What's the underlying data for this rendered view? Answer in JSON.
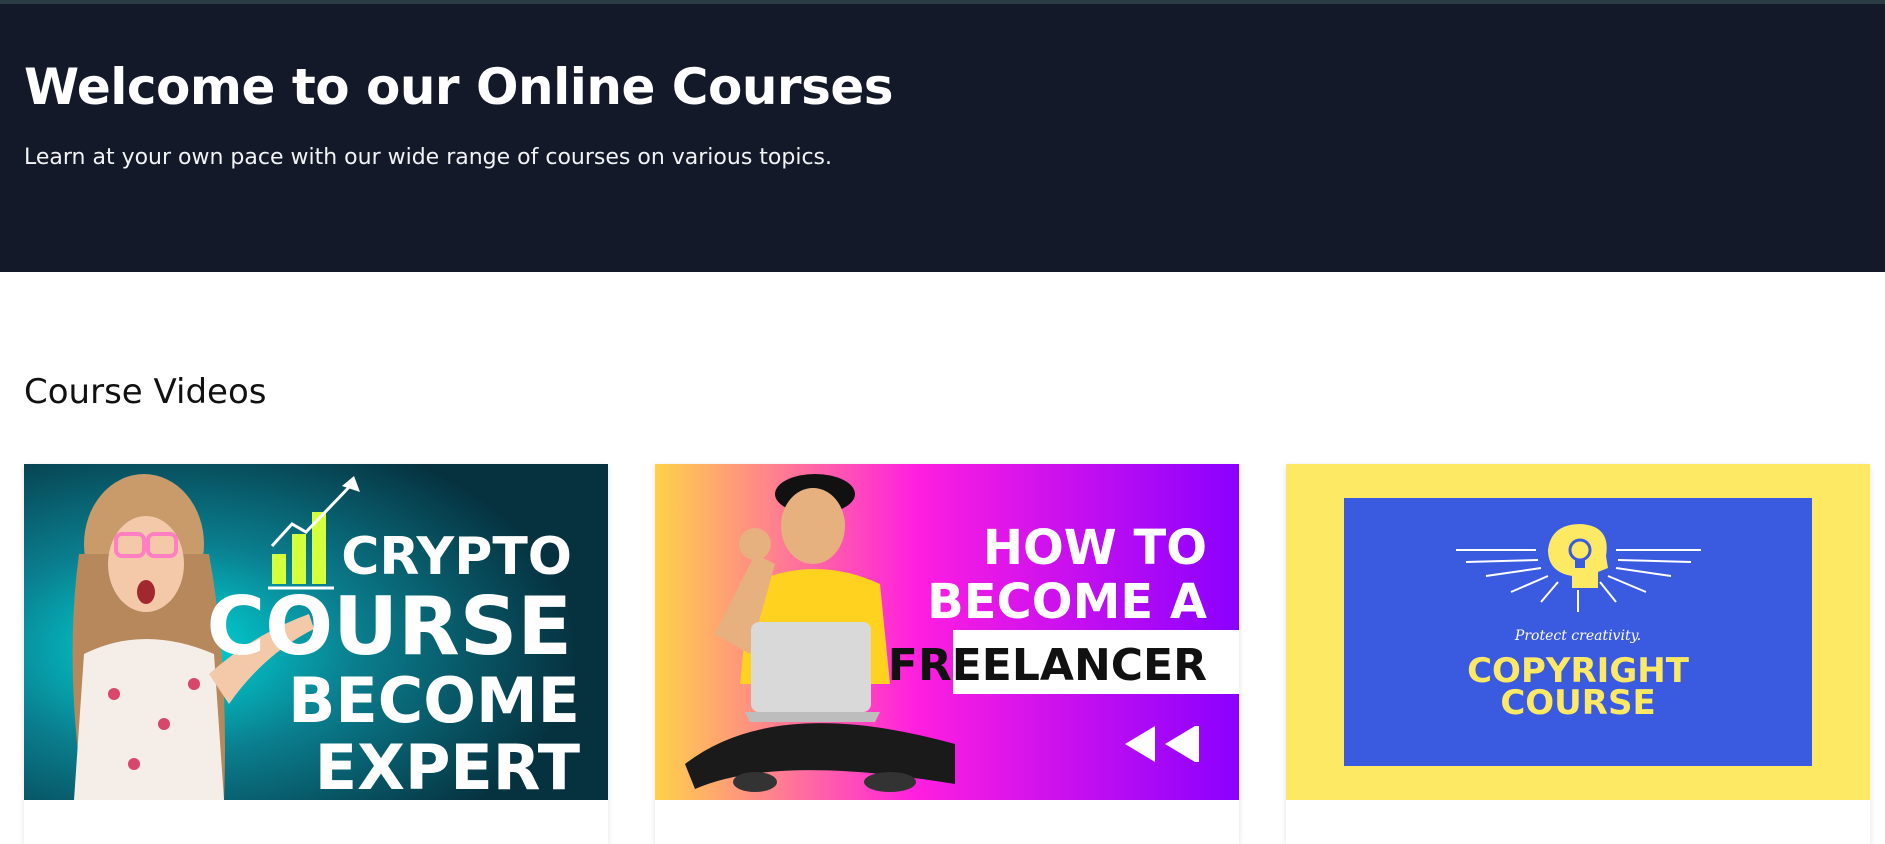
{
  "hero": {
    "title": "Welcome to our Online Courses",
    "subtitle": "Learn at your own pace with our wide range of courses on various topics."
  },
  "section": {
    "title": "Course Videos"
  },
  "courses": [
    {
      "thumb_lines": [
        "CRYPTO",
        "COURSE",
        "BECOME",
        "EXPERT"
      ],
      "colors": {
        "bg": "#06313f",
        "accent": "#00d8d8",
        "chart": "#d4ff3d"
      }
    },
    {
      "thumb_lines": [
        "HOW TO",
        "BECOME A",
        "FREELANCER"
      ],
      "colors": {
        "bg_from": "#ffd24a",
        "bg_mid": "#ff1ee0",
        "bg_to": "#8a00ff",
        "shirt": "#ffd21f"
      }
    },
    {
      "thumb_tagline": "Protect creativity.",
      "thumb_lines": [
        "COPYRIGHT",
        "COURSE"
      ],
      "colors": {
        "border": "#fde964",
        "panel": "#3a5ae0",
        "text": "#fde964"
      }
    }
  ]
}
